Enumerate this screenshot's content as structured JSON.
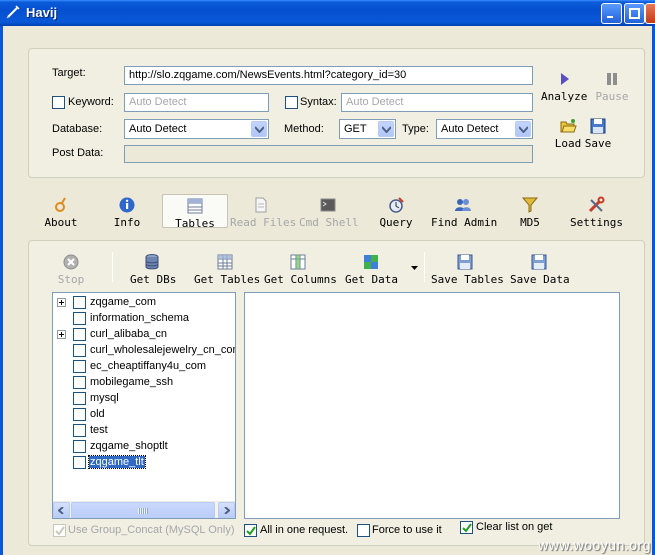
{
  "window": {
    "title": "Havij"
  },
  "form": {
    "target_label": "Target:",
    "target_value": "http://slo.zqgame.com/NewsEvents.html?category_id=30",
    "keyword_label": "Keyword:",
    "keyword_placeholder": "Auto Detect",
    "syntax_label": "Syntax:",
    "syntax_placeholder": "Auto Detect",
    "database_label": "Database:",
    "database_value": "Auto Detect",
    "method_label": "Method:",
    "method_value": "GET",
    "type_label": "Type:",
    "type_value": "Auto Detect",
    "postdata_label": "Post Data:",
    "postdata_value": ""
  },
  "side_actions": {
    "analyze": "Analyze",
    "pause": "Pause",
    "load": "Load",
    "save": "Save"
  },
  "main_toolbar": {
    "about": "About",
    "info": "Info",
    "tables": "Tables",
    "read_files": "Read Files",
    "cmd_shell": "Cmd Shell",
    "query": "Query",
    "find_admin": "Find Admin",
    "md5": "MD5",
    "settings": "Settings"
  },
  "tables_toolbar": {
    "stop": "Stop",
    "get_dbs": "Get DBs",
    "get_tables": "Get Tables",
    "get_columns": "Get Columns",
    "get_data": "Get Data",
    "save_tables": "Save Tables",
    "save_data": "Save Data"
  },
  "databases": [
    {
      "name": "zqgame_com",
      "expandable": true,
      "selected": false
    },
    {
      "name": "information_schema",
      "expandable": false,
      "selected": false
    },
    {
      "name": "curl_alibaba_cn",
      "expandable": true,
      "selected": false
    },
    {
      "name": "curl_wholesalejewelry_cn_com",
      "expandable": false,
      "selected": false
    },
    {
      "name": "ec_cheaptiffany4u_com",
      "expandable": false,
      "selected": false
    },
    {
      "name": "mobilegame_ssh",
      "expandable": false,
      "selected": false
    },
    {
      "name": "mysql",
      "expandable": false,
      "selected": false
    },
    {
      "name": "old",
      "expandable": false,
      "selected": false
    },
    {
      "name": "test",
      "expandable": false,
      "selected": false
    },
    {
      "name": "zqgame_shoptlt",
      "expandable": false,
      "selected": false
    },
    {
      "name": "zqgame_tlt",
      "expandable": false,
      "selected": true
    }
  ],
  "options": {
    "group_concat": "Use Group_Concat (MySQL Only)",
    "all_in_one": "All in one request.",
    "force": "Force to use it",
    "clear_list": "Clear list on get"
  },
  "watermark": "www.wooyun.org",
  "colors": {
    "titlebar": "#0A58D8",
    "selection": "#316AC5",
    "face": "#ECE9D8"
  }
}
